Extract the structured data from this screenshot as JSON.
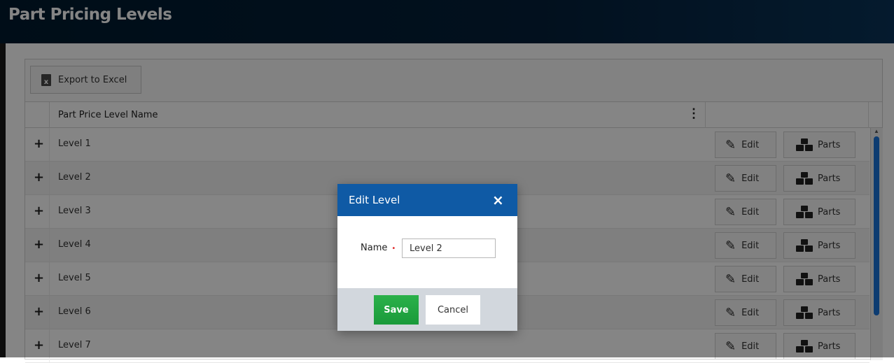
{
  "header": {
    "title": "Part Pricing Levels"
  },
  "toolbar": {
    "export_label": "Export to Excel",
    "export_icon": "excel-file-icon"
  },
  "grid": {
    "column_header": "Part Price Level Name",
    "column_menu_icon": "⋮",
    "rows": [
      {
        "name": "Level 1",
        "edit": "Edit",
        "parts": "Parts"
      },
      {
        "name": "Level 2",
        "edit": "Edit",
        "parts": "Parts"
      },
      {
        "name": "Level 3",
        "edit": "Edit",
        "parts": "Parts"
      },
      {
        "name": "Level 4",
        "edit": "Edit",
        "parts": "Parts"
      },
      {
        "name": "Level 5",
        "edit": "Edit",
        "parts": "Parts"
      },
      {
        "name": "Level 6",
        "edit": "Edit",
        "parts": "Parts"
      },
      {
        "name": "Level 7",
        "edit": "Edit",
        "parts": "Parts"
      }
    ],
    "expand_symbol": "+"
  },
  "modal": {
    "title": "Edit Level",
    "close_symbol": "×",
    "name_label": "Name",
    "required_marker": "•",
    "name_value": "Level 2",
    "save_label": "Save",
    "cancel_label": "Cancel"
  },
  "colors": {
    "header_bg": "#04203a",
    "modal_header_bg": "#0f5aa5",
    "save_green": "#1a9a3a",
    "scrollbar_blue": "#1a73d9",
    "required_red": "#e02b2b"
  }
}
